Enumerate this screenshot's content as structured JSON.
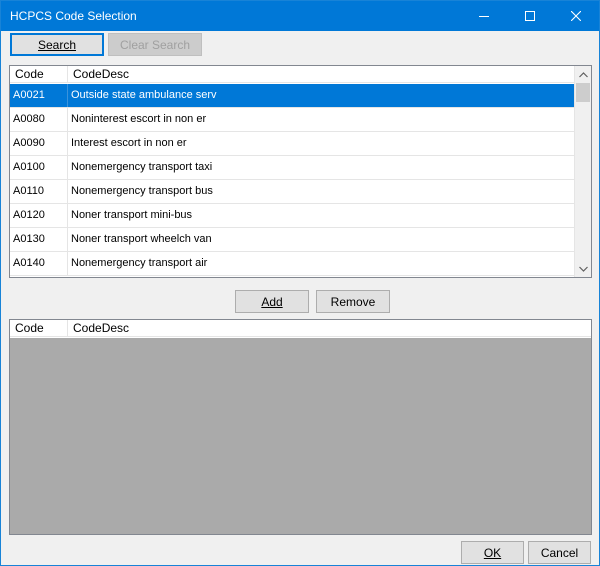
{
  "window": {
    "title": "HCPCS Code Selection"
  },
  "toolbar": {
    "search_label": "Search",
    "clear_search_label": "Clear Search"
  },
  "source_grid": {
    "columns": [
      "Code",
      "CodeDesc"
    ],
    "rows": [
      {
        "code": "A0021",
        "desc": "Outside state ambulance serv",
        "selected": true
      },
      {
        "code": "A0080",
        "desc": "Noninterest escort in non er",
        "selected": false
      },
      {
        "code": "A0090",
        "desc": "Interest escort in non er",
        "selected": false
      },
      {
        "code": "A0100",
        "desc": "Nonemergency transport taxi",
        "selected": false
      },
      {
        "code": "A0110",
        "desc": "Nonemergency transport bus",
        "selected": false
      },
      {
        "code": "A0120",
        "desc": "Noner transport mini-bus",
        "selected": false
      },
      {
        "code": "A0130",
        "desc": "Noner transport wheelch van",
        "selected": false
      },
      {
        "code": "A0140",
        "desc": "Nonemergency transport air",
        "selected": false
      }
    ]
  },
  "actions": {
    "add_label": "Add",
    "remove_label": "Remove"
  },
  "selected_grid": {
    "columns": [
      "Code",
      "CodeDesc"
    ],
    "rows": []
  },
  "footer": {
    "ok_label": "OK",
    "cancel_label": "Cancel"
  },
  "colors": {
    "titlebar": "#0078d7",
    "selection": "#0078d7",
    "empty_area": "#aaaaaa"
  }
}
